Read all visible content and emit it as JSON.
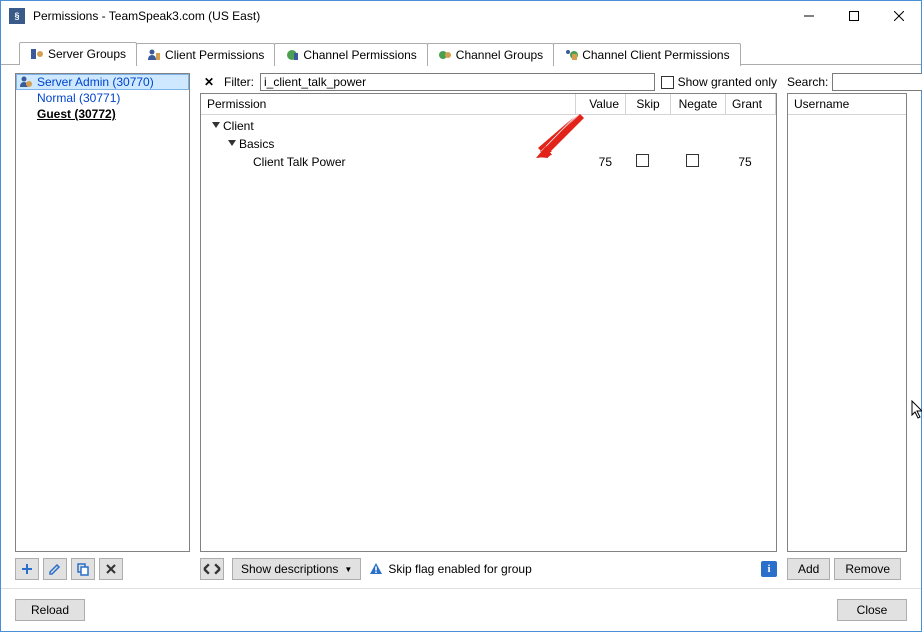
{
  "window": {
    "title": "Permissions - TeamSpeak3.com (US East)"
  },
  "tabs": [
    {
      "label": "Server Groups",
      "icon": "server-group",
      "active": true
    },
    {
      "label": "Client Permissions",
      "icon": "client",
      "active": false
    },
    {
      "label": "Channel Permissions",
      "icon": "channel",
      "active": false
    },
    {
      "label": "Channel Groups",
      "icon": "channel-group",
      "active": false
    },
    {
      "label": "Channel Client Permissions",
      "icon": "channel-client",
      "active": false
    }
  ],
  "groups": [
    {
      "label": "Server Admin (30770)",
      "selected": true,
      "bold": false
    },
    {
      "label": "Normal (30771)",
      "selected": false,
      "bold": false
    },
    {
      "label": "Guest (30772)",
      "selected": false,
      "bold": true
    }
  ],
  "filter": {
    "label": "Filter:",
    "value": "i_client_talk_power",
    "show_granted_label": "Show granted only",
    "show_granted_checked": false
  },
  "perm_columns": {
    "permission": "Permission",
    "value": "Value",
    "skip": "Skip",
    "negate": "Negate",
    "grant": "Grant"
  },
  "perm_tree": {
    "node1": "Client",
    "node2": "Basics",
    "leaf": {
      "name": "Client Talk Power",
      "value": "75",
      "skip": false,
      "negate": false,
      "grant": "75"
    }
  },
  "bottom": {
    "show_descriptions": "Show descriptions",
    "hint": "Skip flag enabled for group"
  },
  "search": {
    "label": "Search:",
    "placeholder": ""
  },
  "user_header": "Username",
  "buttons": {
    "add": "Add",
    "remove": "Remove",
    "reload": "Reload",
    "close": "Close"
  }
}
